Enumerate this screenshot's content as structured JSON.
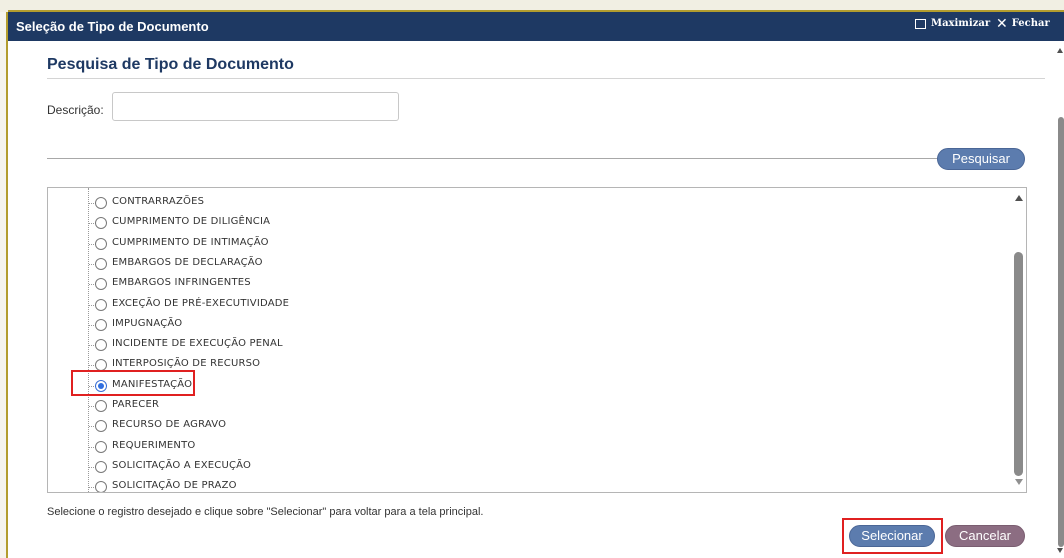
{
  "window": {
    "title": "Seleção de Tipo de Documento",
    "maximize_label": "Maximizar",
    "close_label": "Fechar",
    "titlebar_color": "#1e3963"
  },
  "search": {
    "section_title": "Pesquisa de Tipo de Documento",
    "description_label": "Descrição:",
    "description_value": "",
    "search_button": "Pesquisar"
  },
  "list": {
    "items": [
      {
        "label": "CONTRARRAZÕES",
        "selected": false
      },
      {
        "label": "CUMPRIMENTO DE DILIGÊNCIA",
        "selected": false
      },
      {
        "label": "CUMPRIMENTO DE INTIMAÇÃO",
        "selected": false
      },
      {
        "label": "EMBARGOS DE DECLARAÇÃO",
        "selected": false
      },
      {
        "label": "EMBARGOS INFRINGENTES",
        "selected": false
      },
      {
        "label": "EXCEÇÃO DE PRÉ-EXECUTIVIDADE",
        "selected": false
      },
      {
        "label": "IMPUGNAÇÃO",
        "selected": false
      },
      {
        "label": "INCIDENTE DE EXECUÇÃO PENAL",
        "selected": false
      },
      {
        "label": "INTERPOSIÇÃO DE RECURSO",
        "selected": false
      },
      {
        "label": "MANIFESTAÇÃO",
        "selected": true
      },
      {
        "label": "PARECER",
        "selected": false
      },
      {
        "label": "RECURSO DE AGRAVO",
        "selected": false
      },
      {
        "label": "REQUERIMENTO",
        "selected": false
      },
      {
        "label": "SOLICITAÇÃO A EXECUÇÃO",
        "selected": false
      },
      {
        "label": "SOLICITAÇÃO DE PRAZO",
        "selected": false
      }
    ],
    "selected_label": "MANIFESTAÇÃO"
  },
  "footer": {
    "hint": "Selecione o registro desejado e clique sobre \"Selecionar\" para voltar para a tela principal.",
    "select_button": "Selecionar",
    "cancel_button": "Cancelar"
  },
  "colors": {
    "primary_button": "#5c7cae",
    "cancel_button": "#8c6d82",
    "highlight": "#e02020"
  }
}
